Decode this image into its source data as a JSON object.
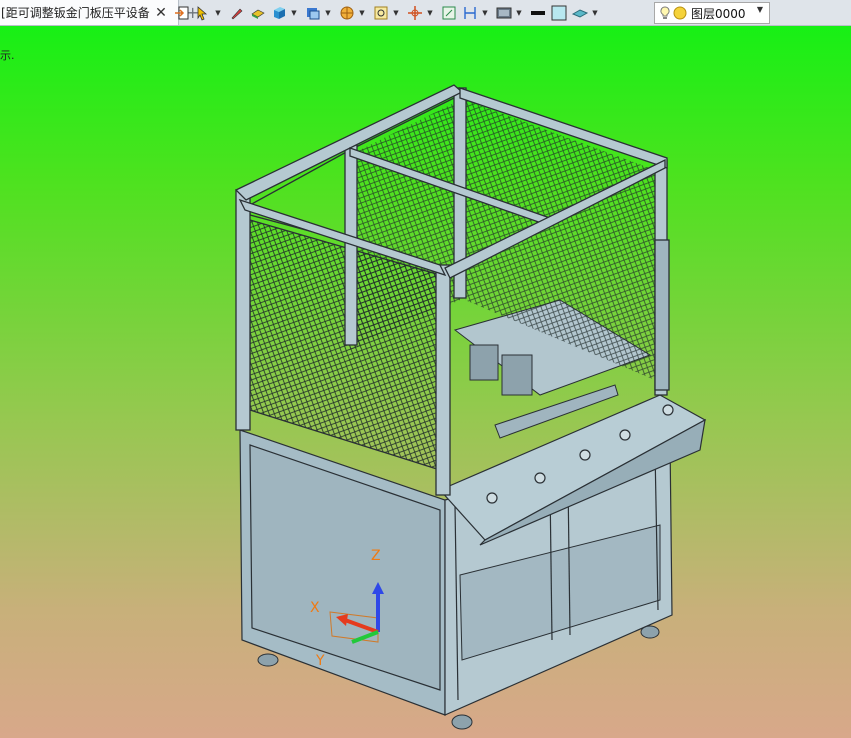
{
  "tab": {
    "title": "距可调整钣金门板压平设备]",
    "close_glyph": "✕",
    "add_glyph": "+"
  },
  "hint": "示.",
  "toolbar": {
    "icons": [
      "import-icon",
      "pointer-select-icon",
      "brush-icon",
      "face-color-icon",
      "box-solid-icon",
      "view-orientation-icon",
      "section-view-icon",
      "zoom-icon",
      "move-axis-icon",
      "fit-view-icon",
      "measure-icon",
      "display-mode-icon",
      "line-style-icon",
      "fill-color-icon",
      "layer-plane-icon"
    ],
    "layer_value": "图层0000"
  },
  "triad": {
    "x": "X",
    "y": "Y",
    "z": "Z"
  },
  "colors": {
    "bg_top": "#17f015",
    "bg_bottom": "#d8a88a",
    "model_fill": "#a9bfc8",
    "model_line": "#2a3035",
    "axis_x": "#e53b1e",
    "axis_y": "#21c93a",
    "axis_z": "#2f48e8",
    "axis_label": "#f07a12"
  }
}
